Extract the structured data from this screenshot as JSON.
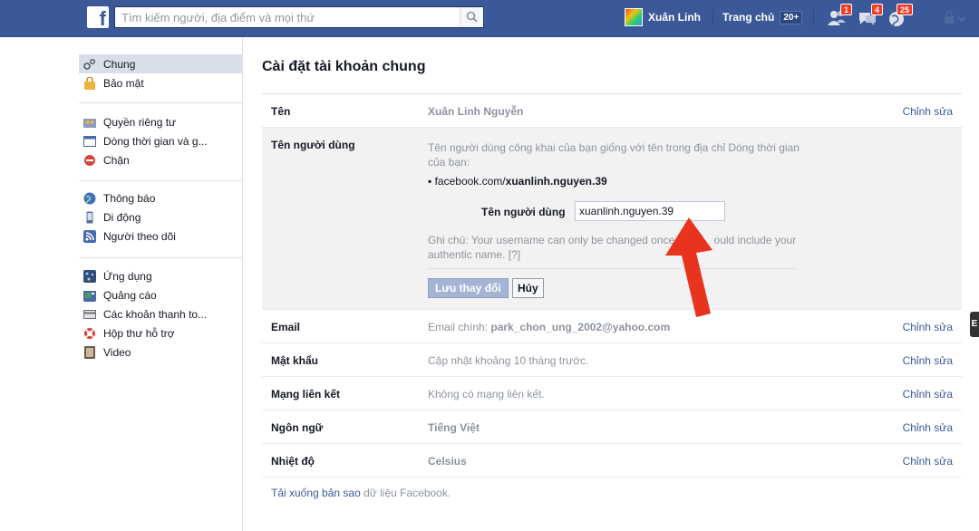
{
  "search": {
    "placeholder": "Tìm kiếm người, địa điểm và mọi thứ"
  },
  "topbar": {
    "logo": "f",
    "user_name": "Xuân Linh",
    "home_label": "Trang chủ",
    "home_count": "20+",
    "friend_requests_count": "1",
    "messages_count": "4",
    "notifications_count": "25"
  },
  "sidebar": {
    "groups": [
      [
        {
          "label": "Chung",
          "icon": "gear-icon",
          "color": "#555"
        },
        {
          "label": "Bảo mật",
          "icon": "lock-icon",
          "color": "#f0b33e"
        }
      ],
      [
        {
          "label": "Quyền riêng tư",
          "icon": "privacy-icon",
          "color": "#6c7b9e"
        },
        {
          "label": "Dòng thời gian và g...",
          "icon": "timeline-icon",
          "color": "#4a69a8"
        },
        {
          "label": "Chặn",
          "icon": "block-icon",
          "color": "#d9453d"
        }
      ],
      [
        {
          "label": "Thông báo",
          "icon": "globe-icon",
          "color": "#3b70c9"
        },
        {
          "label": "Di động",
          "icon": "mobile-icon",
          "color": "#5b6f9b"
        },
        {
          "label": "Người theo dõi",
          "icon": "rss-icon",
          "color": "#4a69a8"
        }
      ],
      [
        {
          "label": "Ứng dụng",
          "icon": "apps-icon",
          "color": "#334c7f"
        },
        {
          "label": "Quảng cáo",
          "icon": "ads-icon",
          "color": "#4aa05a"
        },
        {
          "label": "Các khoản thanh to...",
          "icon": "payment-icon",
          "color": "#6b6f78"
        },
        {
          "label": "Hộp thư hỗ trợ",
          "icon": "support-icon",
          "color": "#d9453d"
        },
        {
          "label": "Video",
          "icon": "video-icon",
          "color": "#6b5b4b"
        }
      ]
    ]
  },
  "main": {
    "title": "Cài đặt tài khoản chung",
    "edit_label": "Chỉnh sửa",
    "rows": {
      "name": {
        "label": "Tên",
        "value": "Xuân Linh Nguyễn"
      },
      "username": {
        "label": "Tên người dùng",
        "description": "Tên người dùng công khai của bạn giống với tên trong địa chỉ Dòng thời gian của bạn:",
        "link_prefix": "facebook.com/",
        "link_username": "xuanlinh.nguyen.39",
        "field_label": "Tên người dùng",
        "field_value": "xuanlinh.nguyen.39",
        "note": "Ghi chú: Your username can only be changed once a",
        "note_end": "ould include your authentic name.",
        "help": "[?]",
        "save_label": "Lưu thay đổi",
        "cancel_label": "Hủy"
      },
      "email": {
        "label": "Email",
        "value_prefix": "Email chính:",
        "value": "park_chon_ung_2002@yahoo.com"
      },
      "password": {
        "label": "Mật khẩu",
        "value": "Cập nhật khoảng 10 tháng trước."
      },
      "networks": {
        "label": "Mạng liên kết",
        "value": "Không có mạng liên kết."
      },
      "language": {
        "label": "Ngôn ngữ",
        "value": "Tiếng Việt"
      },
      "temperature": {
        "label": "Nhiệt độ",
        "value": "Celsius"
      }
    },
    "download_prefix": "Tải xuống bản sao",
    "download_link": "dữ liệu Facebook."
  },
  "side_tab": "E"
}
